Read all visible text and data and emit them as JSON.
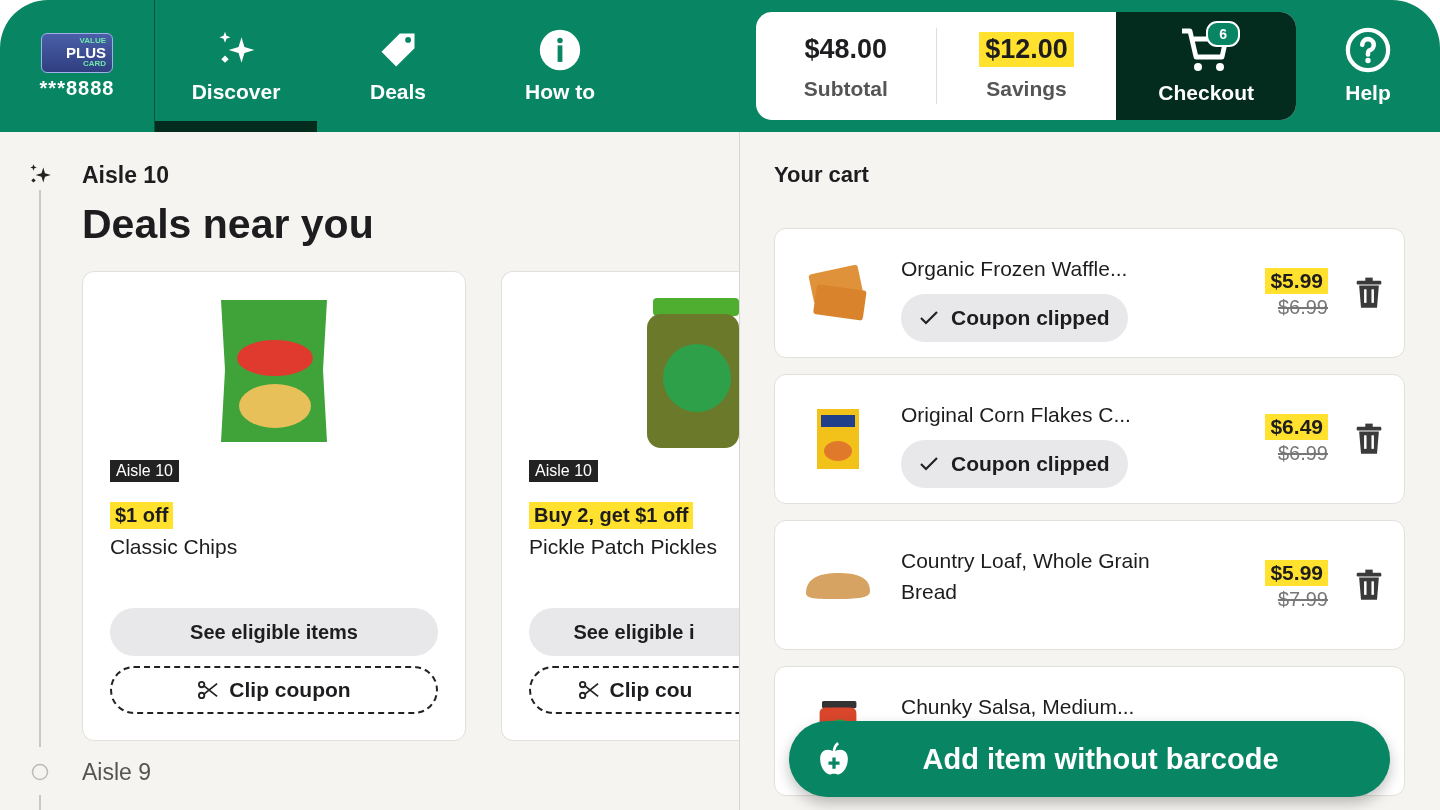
{
  "account": {
    "card_logo": [
      "VALUE",
      "PLUS",
      "CARD"
    ],
    "number": "***8888"
  },
  "tabs": [
    {
      "label": "Discover",
      "kind": "sparkle",
      "selected": true
    },
    {
      "label": "Deals",
      "kind": "tag",
      "selected": false
    },
    {
      "label": "How to",
      "kind": "info",
      "selected": false
    }
  ],
  "summary": {
    "subtotal": "$48.00",
    "subtotal_label": "Subtotal",
    "savings": "$12.00",
    "savings_label": "Savings"
  },
  "checkout": {
    "label": "Checkout",
    "count": "6"
  },
  "help": {
    "label": "Help"
  },
  "aisles": [
    {
      "label": "Aisle 10",
      "current": true
    },
    {
      "label": "Aisle 9",
      "current": false
    }
  ],
  "deals": {
    "title": "Deals near you",
    "cards": [
      {
        "kind": "bag",
        "aisle": "Aisle 10",
        "offer": "$1 off",
        "name": "Classic Chips",
        "eligible_button": "See eligible items",
        "clip_button": "Clip coupon"
      },
      {
        "kind": "jar",
        "aisle": "Aisle 10",
        "offer": "Buy 2, get $1 off",
        "name": "Pickle Patch Pickles",
        "eligible_button": "See eligible i",
        "clip_button": "Clip cou"
      }
    ]
  },
  "cart": {
    "title": "Your cart",
    "items": [
      {
        "kind": "waffle",
        "name": "Organic Frozen Waffle...",
        "coupon_clipped": true,
        "coupon_label": "Coupon clipped",
        "price": "$5.99",
        "original_price": "$6.99"
      },
      {
        "kind": "box",
        "name": "Original Corn Flakes C...",
        "coupon_clipped": true,
        "coupon_label": "Coupon clipped",
        "price": "$6.49",
        "original_price": "$6.99"
      },
      {
        "kind": "bread",
        "name": "Country Loaf, Whole Grain Bread",
        "coupon_clipped": false,
        "price": "$5.99",
        "original_price": "$7.99"
      },
      {
        "kind": "jar",
        "name": "Chunky Salsa, Medium..."
      }
    ]
  },
  "add_button": {
    "label": "Add item without barcode"
  }
}
